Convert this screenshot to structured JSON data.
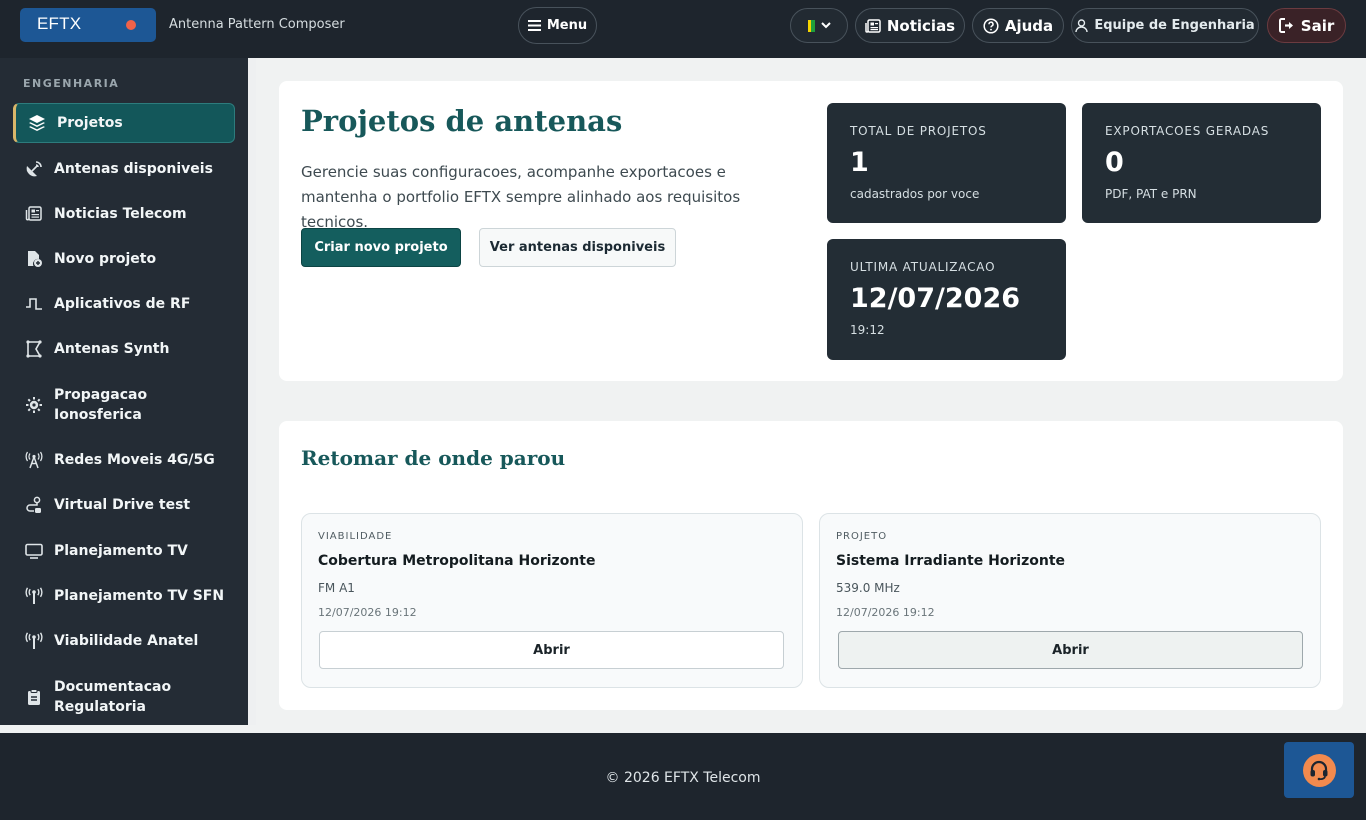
{
  "header": {
    "logo": "EFTX",
    "subtitle": "Antenna Pattern Composer",
    "menu_label": "Menu",
    "news_label": "Noticias",
    "help_label": "Ajuda",
    "team_label": "Equipe de Engenharia",
    "logout_label": "Sair",
    "language_flag": "brazil-flag"
  },
  "sidebar": {
    "section": "ENGENHARIA",
    "items": [
      {
        "label": "Projetos",
        "icon": "layers-icon",
        "active": true
      },
      {
        "label": "Antenas disponiveis",
        "icon": "satellite-dish-icon"
      },
      {
        "label": "Noticias Telecom",
        "icon": "newspaper-icon"
      },
      {
        "label": "Novo projeto",
        "icon": "new-file-icon"
      },
      {
        "label": "Aplicativos de RF",
        "icon": "signal-wave-icon"
      },
      {
        "label": "Antenas Synth",
        "icon": "synth-shape-icon"
      },
      {
        "label": "Propagacao Ionosferica",
        "icon": "sun-gear-icon"
      },
      {
        "label": "Redes Moveis 4G/5G",
        "icon": "cell-tower-icon"
      },
      {
        "label": "Virtual Drive test",
        "icon": "route-icon"
      },
      {
        "label": "Planejamento TV",
        "icon": "monitor-icon"
      },
      {
        "label": "Planejamento TV SFN",
        "icon": "broadcast-antenna-icon"
      },
      {
        "label": "Viabilidade Anatel",
        "icon": "broadcast-antenna-icon"
      },
      {
        "label": "Documentacao Regulatoria",
        "icon": "clipboard-icon"
      }
    ]
  },
  "hero": {
    "title": "Projetos de antenas",
    "description": "Gerencie suas configuracoes, acompanhe exportacoes e mantenha o portfolio EFTX sempre alinhado aos requisitos tecnicos.",
    "primary_button": "Criar novo projeto",
    "secondary_button": "Ver antenas disponiveis"
  },
  "stats": [
    {
      "label": "TOTAL DE PROJETOS",
      "value": "1",
      "sub": "cadastrados por voce"
    },
    {
      "label": "EXPORTACOES GERADAS",
      "value": "0",
      "sub": "PDF, PAT e PRN"
    },
    {
      "label": "ULTIMA ATUALIZACAO",
      "value": "12/07/2026",
      "sub": "19:12"
    }
  ],
  "resume": {
    "title": "Retomar de onde parou",
    "items": [
      {
        "kind": "VIABILIDADE",
        "name": "Cobertura Metropolitana Horizonte",
        "meta": "FM A1",
        "date": "12/07/2026 19:12",
        "action": "Abrir"
      },
      {
        "kind": "PROJETO",
        "name": "Sistema Irradiante Horizonte",
        "meta": "539.0 MHz",
        "date": "12/07/2026 19:12",
        "action": "Abrir"
      }
    ]
  },
  "footer": {
    "copyright": "© 2026 EFTX Telecom"
  },
  "colors": {
    "brand": "#1d5795",
    "accent": "#145e5e",
    "dark": "#1e252d",
    "support": "#f28a4e"
  }
}
